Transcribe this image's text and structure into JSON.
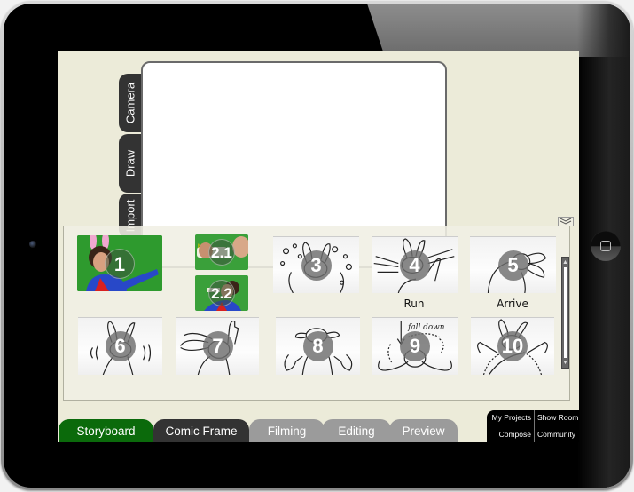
{
  "app": {
    "side_tabs": [
      {
        "label": "Camera"
      },
      {
        "label": "Draw"
      },
      {
        "label": "Import"
      }
    ],
    "frames": [
      {
        "number": "1",
        "kind": "photo",
        "caption": ""
      },
      {
        "number": "2.1",
        "kind": "photo",
        "caption": ""
      },
      {
        "number": "2.2",
        "kind": "photo",
        "caption": ""
      },
      {
        "number": "3",
        "kind": "sketch",
        "caption": ""
      },
      {
        "number": "4",
        "kind": "sketch",
        "caption": "Run"
      },
      {
        "number": "5",
        "kind": "sketch",
        "caption": "Arrive"
      },
      {
        "number": "6",
        "kind": "sketch",
        "caption": ""
      },
      {
        "number": "7",
        "kind": "sketch",
        "caption": ""
      },
      {
        "number": "8",
        "kind": "sketch",
        "caption": ""
      },
      {
        "number": "9",
        "kind": "sketch",
        "caption": "",
        "annotation": "fall down"
      },
      {
        "number": "10",
        "kind": "sketch",
        "caption": ""
      }
    ],
    "bottom_tabs": [
      {
        "label": "Storyboard",
        "active": true,
        "color": "#0b6a0b"
      },
      {
        "label": "Comic Frame",
        "color": "#333333"
      },
      {
        "label": "Filming",
        "color": "#9b9b9b"
      },
      {
        "label": "Editing",
        "color": "#9b9b9b"
      },
      {
        "label": "Preview",
        "color": "#9b9b9b"
      }
    ],
    "nav_links": {
      "my_projects": "My Projects",
      "show_room": "Show Room",
      "compose": "Compose",
      "community": "Community"
    },
    "icons": {
      "collapse": "chevron-double-down-icon",
      "scroll_up": "▲",
      "scroll_down": "▼"
    },
    "colors": {
      "screen_bg": "#ecebd9",
      "active_tab": "#0b6a0b",
      "dark_tab": "#333333",
      "inactive_tab": "#9b9b9b"
    }
  }
}
